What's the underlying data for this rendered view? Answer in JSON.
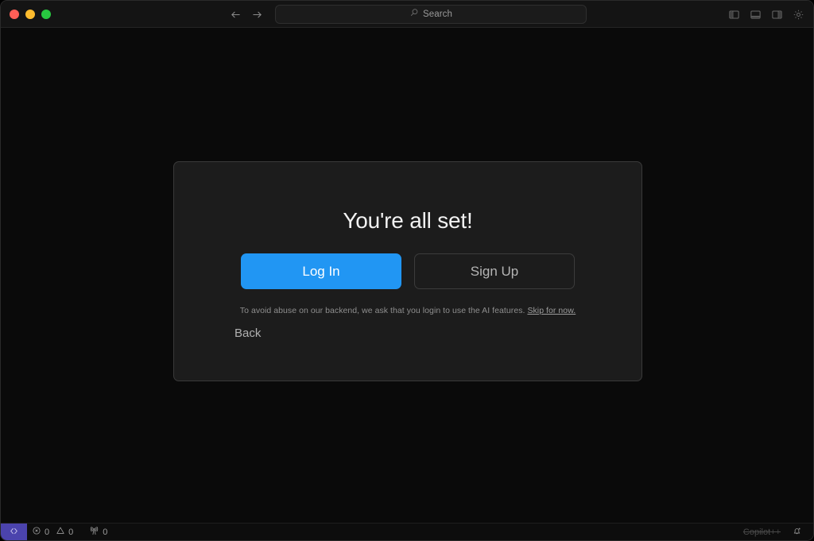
{
  "window": {
    "traffic_lights": [
      {
        "name": "close",
        "color": "#ff5f57"
      },
      {
        "name": "minimize",
        "color": "#febc2e"
      },
      {
        "name": "maximize",
        "color": "#28c840"
      }
    ]
  },
  "titlebar": {
    "back_icon": "arrow-left-icon",
    "forward_icon": "arrow-right-icon",
    "search": {
      "icon": "search-icon",
      "placeholder": "Search",
      "value": ""
    },
    "right_actions": [
      {
        "name": "toggle-primary-sidebar",
        "icon": "layout-sidebar-left-icon"
      },
      {
        "name": "toggle-panel",
        "icon": "layout-panel-bottom-icon"
      },
      {
        "name": "toggle-secondary-sidebar",
        "icon": "layout-sidebar-right-icon"
      },
      {
        "name": "settings",
        "icon": "gear-icon"
      }
    ]
  },
  "card": {
    "title": "You're all set!",
    "primary_button": "Log In",
    "secondary_button": "Sign Up",
    "note_text": "To avoid abuse on our backend, we ask that you login to use the AI features. ",
    "note_link": "Skip for now.",
    "back_button": "Back"
  },
  "statusbar": {
    "remote_icon": "remote-window-icon",
    "errors": {
      "icon": "error-circle-icon",
      "count": "0"
    },
    "warnings": {
      "icon": "warning-triangle-icon",
      "count": "0"
    },
    "ports": {
      "icon": "radio-tower-icon",
      "count": "0"
    },
    "copilot_label": "Copilot++",
    "notifications_icon": "bell-dot-icon"
  },
  "colors": {
    "accent": "#2196f3",
    "remote_badge": "#4b43ad",
    "window_bg": "#0a0a0a",
    "card_bg": "#1c1c1c",
    "titlebar_bg": "#141414"
  }
}
